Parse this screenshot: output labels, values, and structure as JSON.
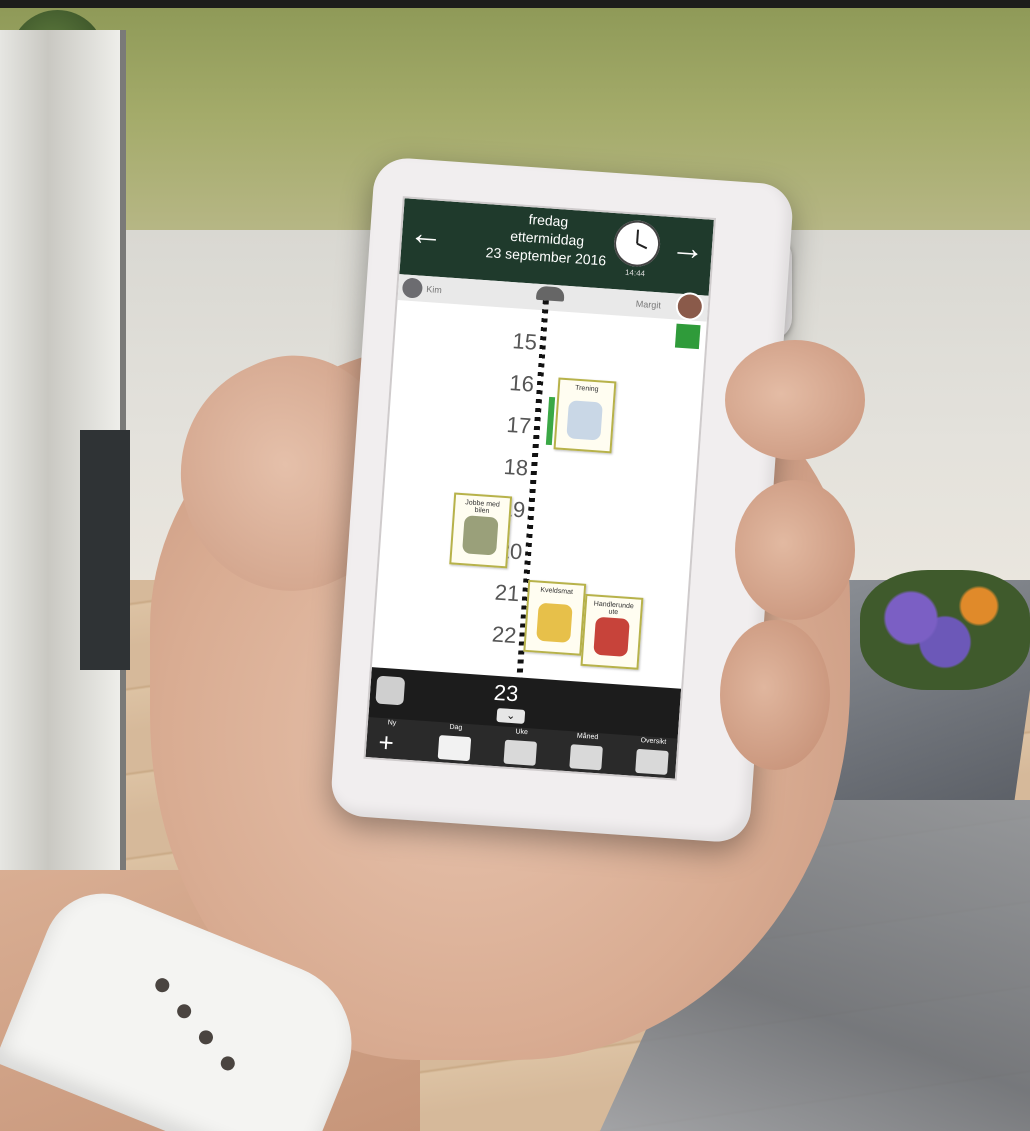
{
  "device_screen": {
    "header": {
      "day": "fredag",
      "part_of_day": "ettermiddag",
      "date": "23 september 2016",
      "clock_time": "14:44"
    },
    "people": {
      "left_name": "Kim",
      "right_name": "Margit"
    },
    "hours": [
      "15",
      "16",
      "17",
      "18",
      "19",
      "20",
      "21",
      "22",
      "23"
    ],
    "activities": [
      {
        "label": "Trening",
        "color": "#c9d7e6"
      },
      {
        "label": "Jobbe med bilen",
        "color": "#9aa07a"
      },
      {
        "label": "Kveldsmat",
        "color": "#e7c04a"
      },
      {
        "label": "Handlerunde ute",
        "color": "#c7433a"
      }
    ],
    "toolbar": [
      "Ny",
      "Dag",
      "Uke",
      "Måned",
      "Oversikt"
    ]
  }
}
